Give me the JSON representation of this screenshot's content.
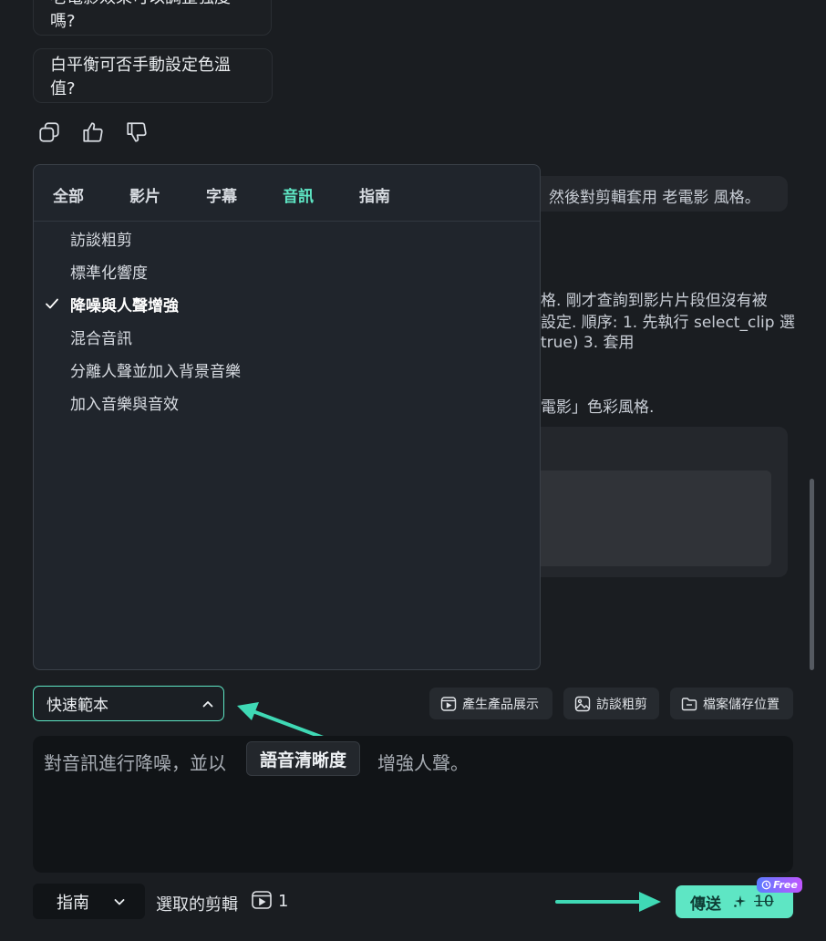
{
  "suggestions": [
    "老電影效果可以調整強度嗎?",
    "白平衡可否手動設定色溫值?"
  ],
  "background_text": {
    "line1": "然後對剪輯套用 老電影 風格。",
    "line2": "格. 剛才查詢到影片片段但沒有被",
    "line3": "設定. 順序: 1. 先執行 select_clip 選",
    "line4": "true)   3. 套用",
    "line5": "電影」色彩風格."
  },
  "dropdown": {
    "tabs": [
      "全部",
      "影片",
      "字幕",
      "音訊",
      "指南"
    ],
    "active_tab": "音訊",
    "items": [
      "訪談粗剪",
      "標準化響度",
      "降噪與人聲增強",
      "混合音訊",
      "分離人聲並加入背景音樂",
      "加入音樂與音效"
    ],
    "selected_item": "降噪與人聲增強"
  },
  "quick_template": {
    "label": "快速範本"
  },
  "shortcuts": [
    {
      "label": "產生產品展示",
      "icon": "video-icon"
    },
    {
      "label": "訪談粗剪",
      "icon": "image-icon"
    },
    {
      "label": "檔案儲存位置",
      "icon": "folder-icon"
    }
  ],
  "prompt": {
    "text": "對音訊進行降噪，並以",
    "chip": "語音清晰度",
    "suffix": "增強人聲。"
  },
  "footer": {
    "mode": "指南",
    "selected_clips_label": "選取的剪輯",
    "selected_clips_count": "1",
    "send_label": "傳送",
    "credit_cost": "10",
    "free_badge": "Free"
  },
  "colors": {
    "accent": "#5ee6c4",
    "background": "#1a1d21"
  }
}
